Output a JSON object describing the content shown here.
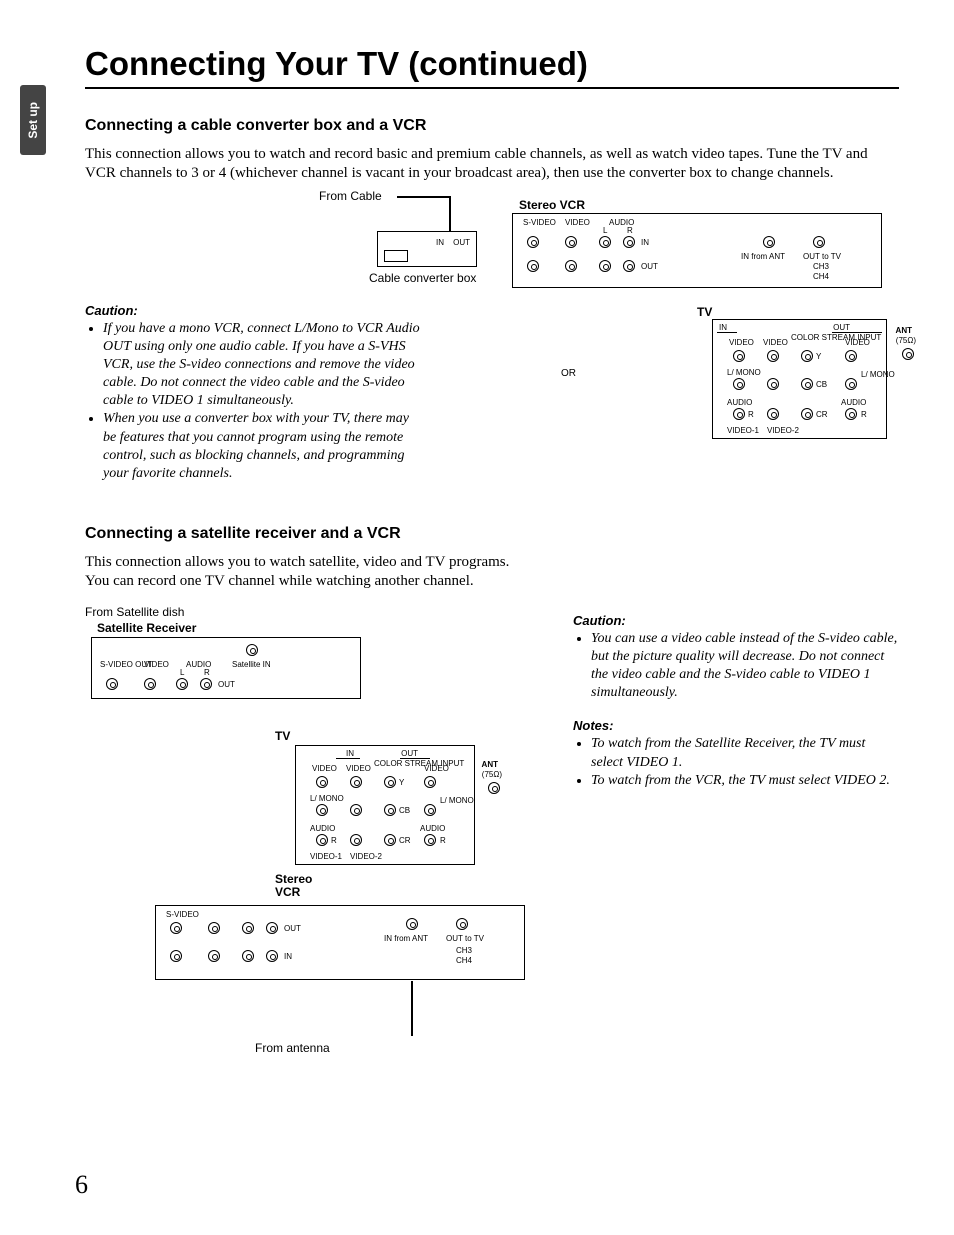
{
  "sideTab": "Set up",
  "pageTitle": "Connecting Your TV (continued)",
  "section1": {
    "heading": "Connecting a cable converter box and a VCR",
    "intro": "This connection allows you to watch and record basic and premium cable channels, as well as watch video tapes. Tune the TV and VCR channels to 3 or 4 (whichever channel is vacant in your broadcast area), then use the converter box to change channels.",
    "cautionLabel": "Caution:",
    "cautions": [
      "If you have a mono VCR, connect L/Mono to VCR Audio OUT using only one audio cable. If you have a S-VHS VCR, use the S-video connections and remove the video cable. Do not connect the video cable and the S-video cable to VIDEO 1 simultaneously.",
      "When you use a converter box with your TV, there may be features that you cannot program using the remote control, such as blocking channels, and programming your favorite channels."
    ],
    "diagram": {
      "fromCable": "From Cable",
      "converterBox": "Cable converter box",
      "in": "IN",
      "out": "OUT",
      "stereoVcr": "Stereo VCR",
      "svideo": "S-VIDEO",
      "video": "VIDEO",
      "audio": "AUDIO",
      "l": "L",
      "r": "R",
      "inFromAnt": "IN from ANT",
      "outToTv": "OUT to TV",
      "ch3": "CH3",
      "ch4": "CH4",
      "tv": "TV",
      "ant": "ANT",
      "ohm": "(75Ω)",
      "lmono": "L/ MONO",
      "y": "Y",
      "cb": "CB",
      "cr": "CR",
      "colorStream": "COLOR STREAM INPUT",
      "video1": "VIDEO-1",
      "video2": "VIDEO-2",
      "or": "OR"
    }
  },
  "section2": {
    "heading": "Connecting a satellite receiver and a VCR",
    "intro1": "This connection allows you to watch satellite, video and TV programs.",
    "intro2": "You can record one TV channel while watching another channel.",
    "cautionLabel": "Caution:",
    "cautions": [
      "You can use a video cable instead of the S-video cable, but the picture quality will decrease. Do not connect the video cable and the S-video cable to VIDEO 1 simultaneously."
    ],
    "notesLabel": "Notes:",
    "notes": [
      "To watch from the Satellite Receiver, the TV must select VIDEO 1.",
      "To watch from the VCR, the TV must select VIDEO 2."
    ],
    "diagram": {
      "fromSatDish": "From Satellite dish",
      "satReceiver": "Satellite Receiver",
      "satelliteIn": "Satellite IN",
      "svideoOut": "S-VIDEO OUT",
      "video": "VIDEO",
      "audio": "AUDIO",
      "l": "L",
      "r": "R",
      "out": "OUT",
      "in": "IN",
      "tv": "TV",
      "ant": "ANT",
      "ohm": "(75Ω)",
      "lmono": "L/ MONO",
      "y": "Y",
      "cb": "CB",
      "cr": "CR",
      "colorStream": "COLOR STREAM INPUT",
      "video1": "VIDEO-1",
      "video2": "VIDEO-2",
      "stereoVcr": "Stereo VCR",
      "svideo": "S-VIDEO",
      "inFromAnt": "IN from ANT",
      "outToTv": "OUT to TV",
      "ch3": "CH3",
      "ch4": "CH4",
      "fromAntenna": "From antenna"
    }
  },
  "pageNumber": "6"
}
